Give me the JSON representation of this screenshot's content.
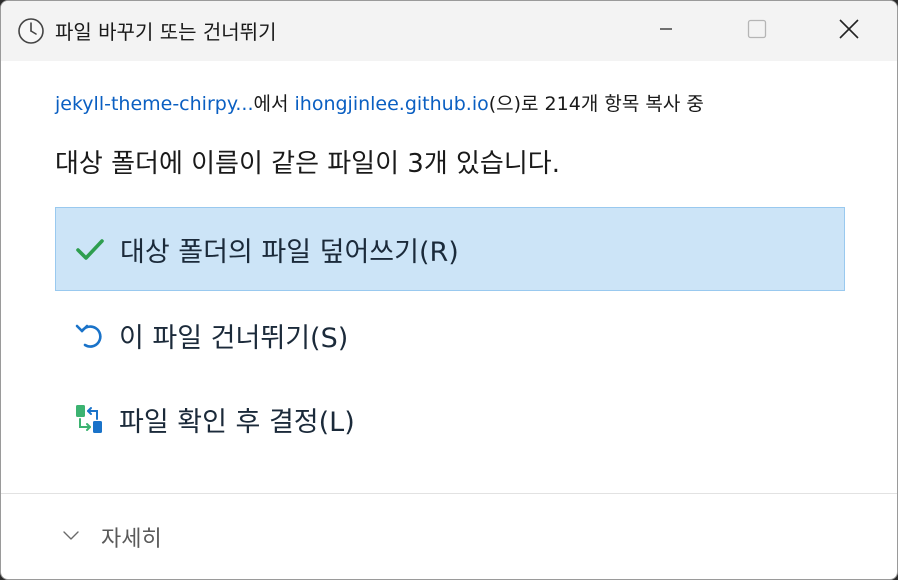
{
  "window": {
    "title": "파일 바꾸기 또는 건너뛰기",
    "icon": "clock-icon"
  },
  "controls": {
    "minimize_icon": "minimize-icon",
    "maximize_icon": "maximize-icon",
    "close_icon": "close-icon"
  },
  "copy_info": {
    "source": "jekyll-theme-chirpy...",
    "from_suffix": "에서",
    "destination": "ihongjinlee.github.io",
    "rest": "(으)로 214개 항목 복사 중"
  },
  "heading": "대상 폴더에 이름이 같은 파일이 3개 있습니다.",
  "options": [
    {
      "label": "대상 폴더의 파일 덮어쓰기(R)",
      "icon": "checkmark-icon",
      "selected": true
    },
    {
      "label": "이 파일 건너뛰기(S)",
      "icon": "undo-arrow-icon",
      "selected": false
    },
    {
      "label": "파일 확인 후 결정(L)",
      "icon": "compare-files-icon",
      "selected": false
    }
  ],
  "details": {
    "label": "자세히",
    "icon": "chevron-down-icon"
  },
  "colors": {
    "link": "#0a5fc2",
    "selected_bg": "#cce4f7",
    "selected_border": "#99c9ef",
    "check_green": "#2e9e4f",
    "accent_blue": "#1a73c9"
  }
}
